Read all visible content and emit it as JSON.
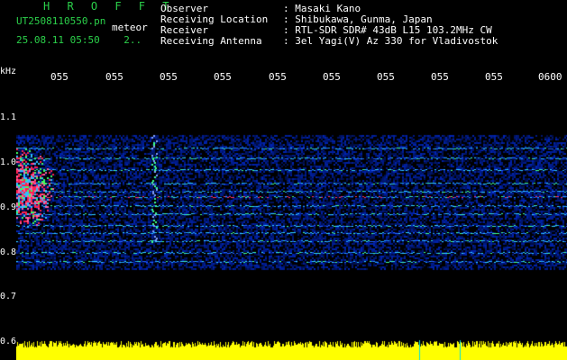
{
  "header": {
    "brand": "H R O F F T",
    "filename": "UT2508110550.pn",
    "tag": "meteor",
    "timestamp": "25.08.11 05:50    2.."
  },
  "meta": [
    {
      "label": "Observer",
      "value": ": Masaki Kano"
    },
    {
      "label": "Receiving Location",
      "value": ": Shibukawa, Gunma, Japan"
    },
    {
      "label": "Receiver",
      "value": ": RTL-SDR SDR# 43dB L15 103.2MHz CW"
    },
    {
      "label": "Receiving Antenna",
      "value": ": 3el Yagi(V) Az 330 for Vladivostok"
    }
  ],
  "axis": {
    "unit": "kHz",
    "y_ticks": [
      "1.1",
      "1.0",
      "0.9",
      "0.8",
      "0.7",
      "0.6"
    ],
    "x_ticks": [
      "055",
      "055",
      "055",
      "055",
      "055",
      "055",
      "055",
      "055",
      "055",
      "0600"
    ]
  },
  "colors": {
    "label_green": "#2bd04a",
    "text_white": "#ffffff",
    "background": "#000000",
    "level_bar": "#ffff00",
    "strong_signal": "#ff2050"
  }
}
